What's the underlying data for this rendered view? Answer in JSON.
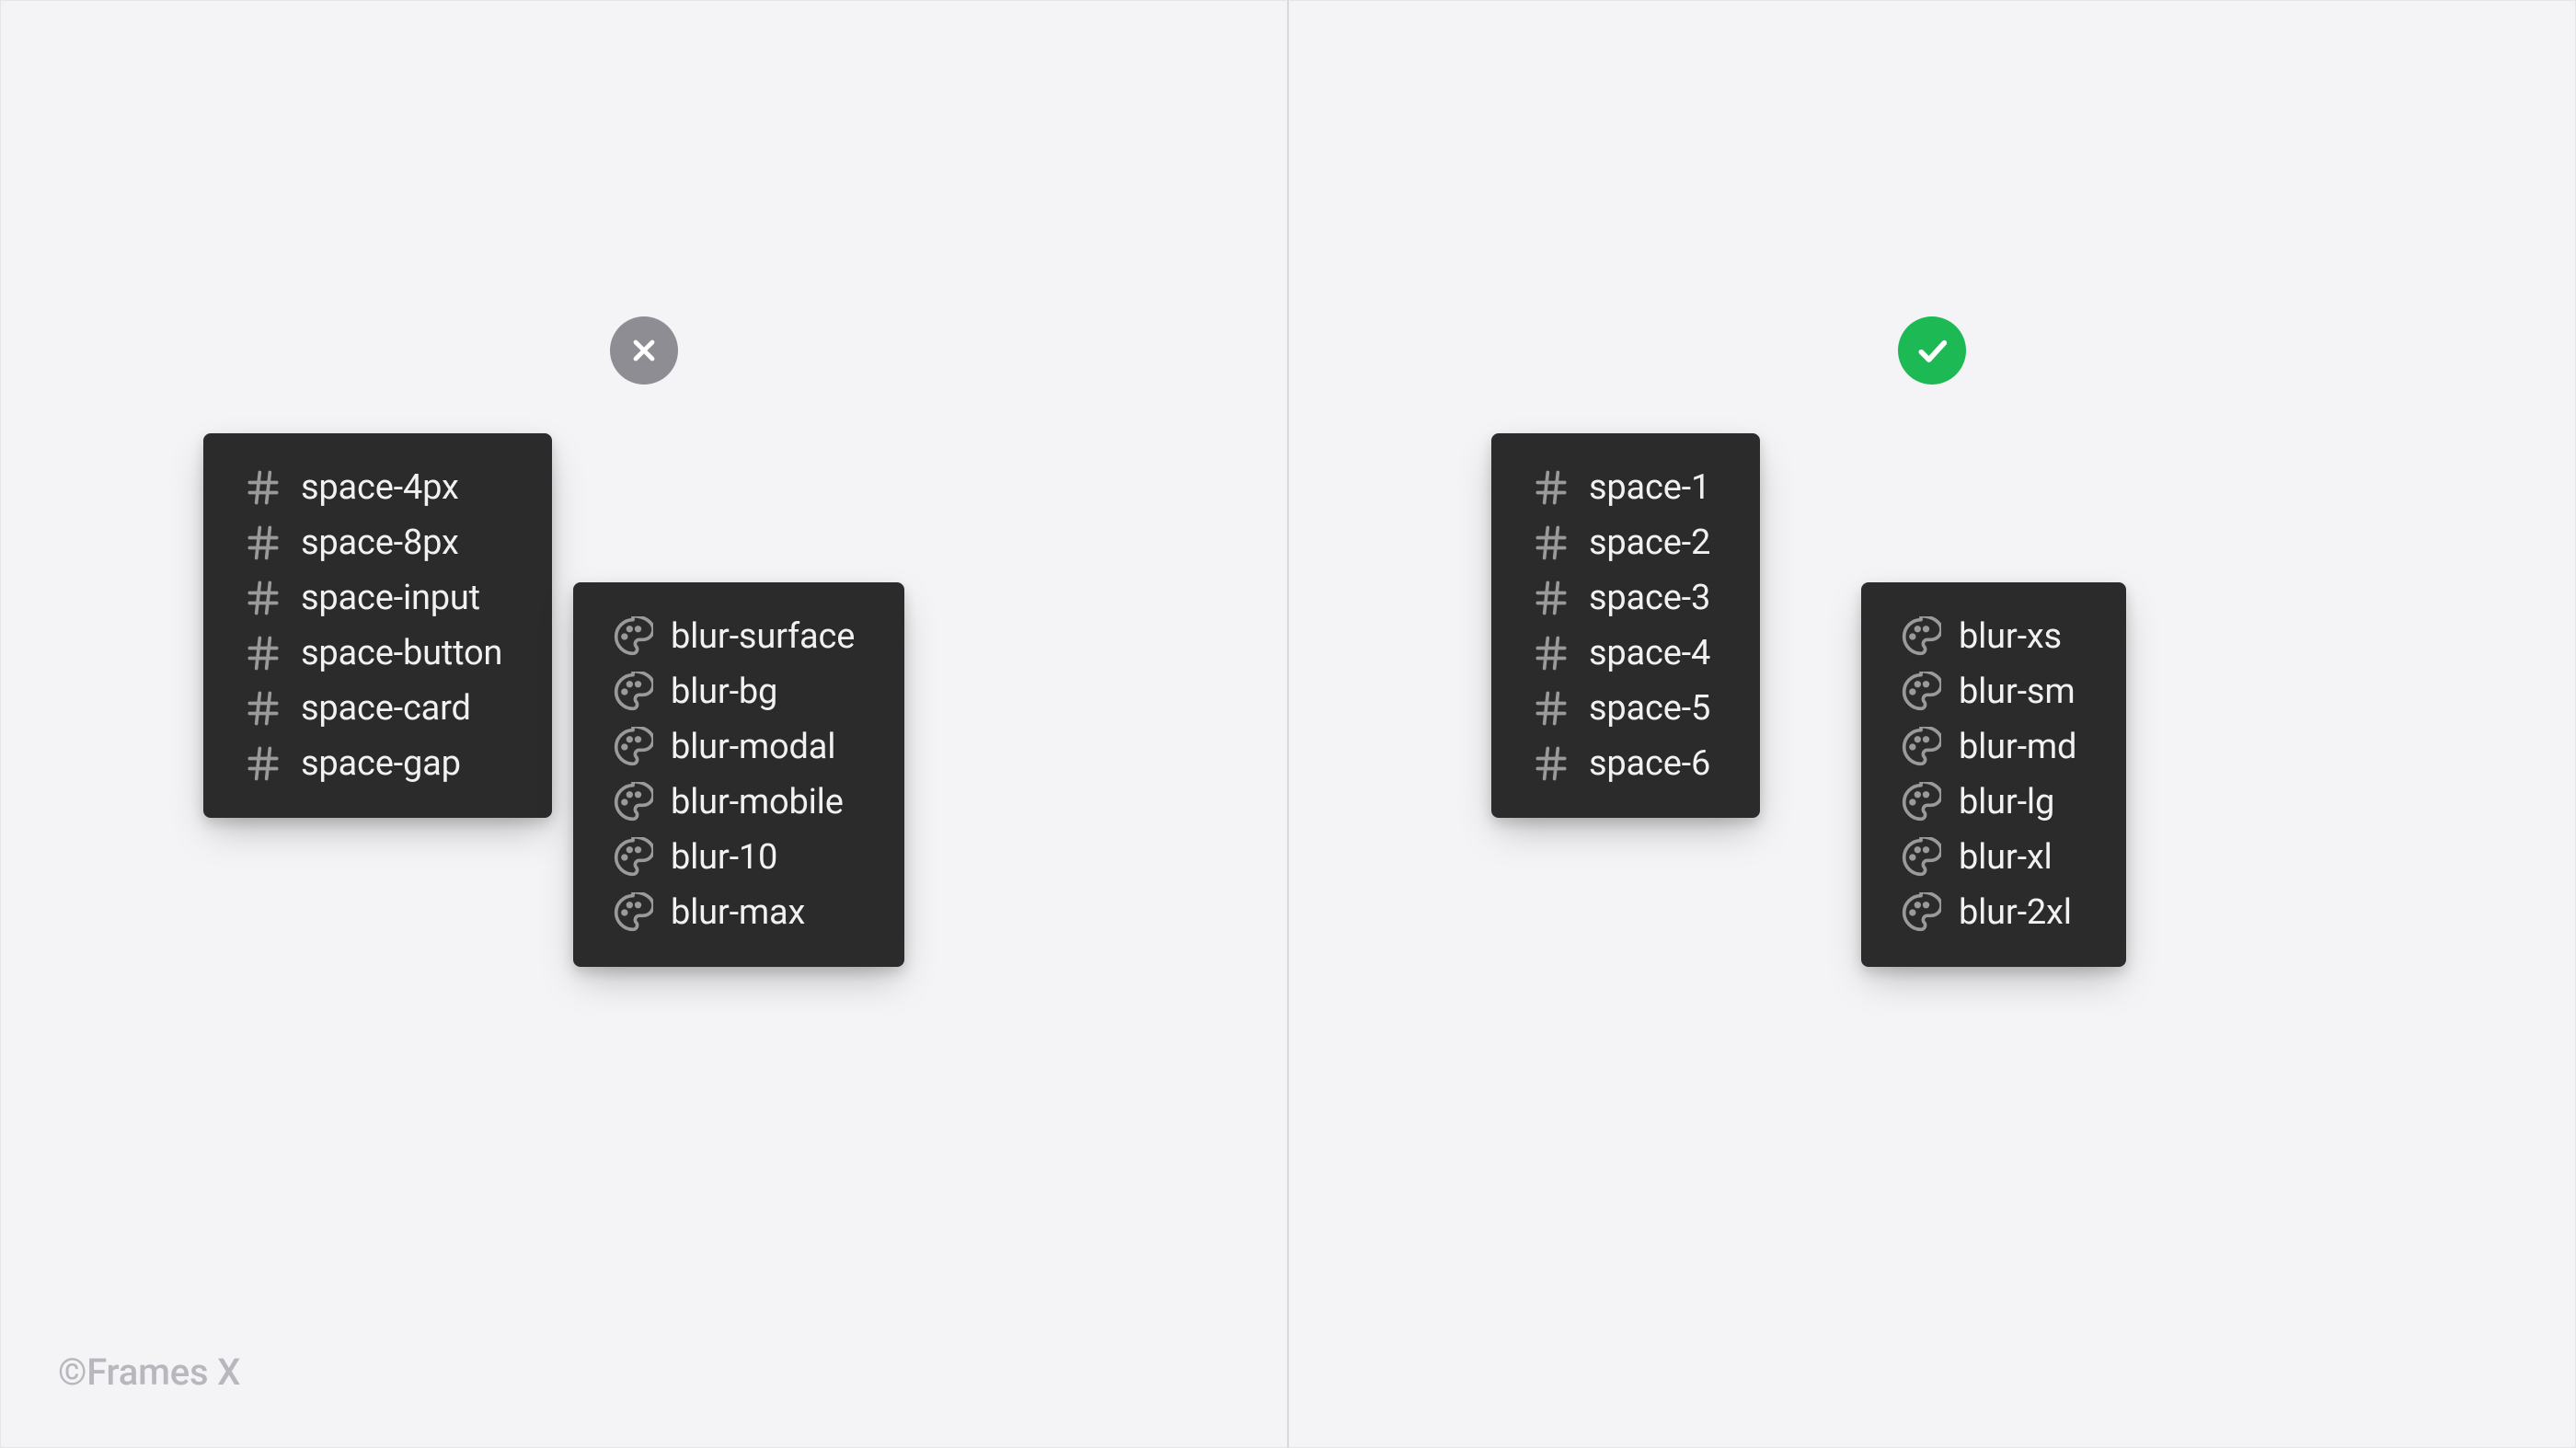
{
  "credit": "©Frames X",
  "left": {
    "status": "bad",
    "space": [
      "space-4px",
      "space-8px",
      "space-input",
      "space-button",
      "space-card",
      "space-gap"
    ],
    "blur": [
      "blur-surface",
      "blur-bg",
      "blur-modal",
      "blur-mobile",
      "blur-10",
      "blur-max"
    ]
  },
  "right": {
    "status": "good",
    "space": [
      "space-1",
      "space-2",
      "space-3",
      "space-4",
      "space-5",
      "space-6"
    ],
    "blur": [
      "blur-xs",
      "blur-sm",
      "blur-md",
      "blur-lg",
      "blur-xl",
      "blur-2xl"
    ]
  }
}
